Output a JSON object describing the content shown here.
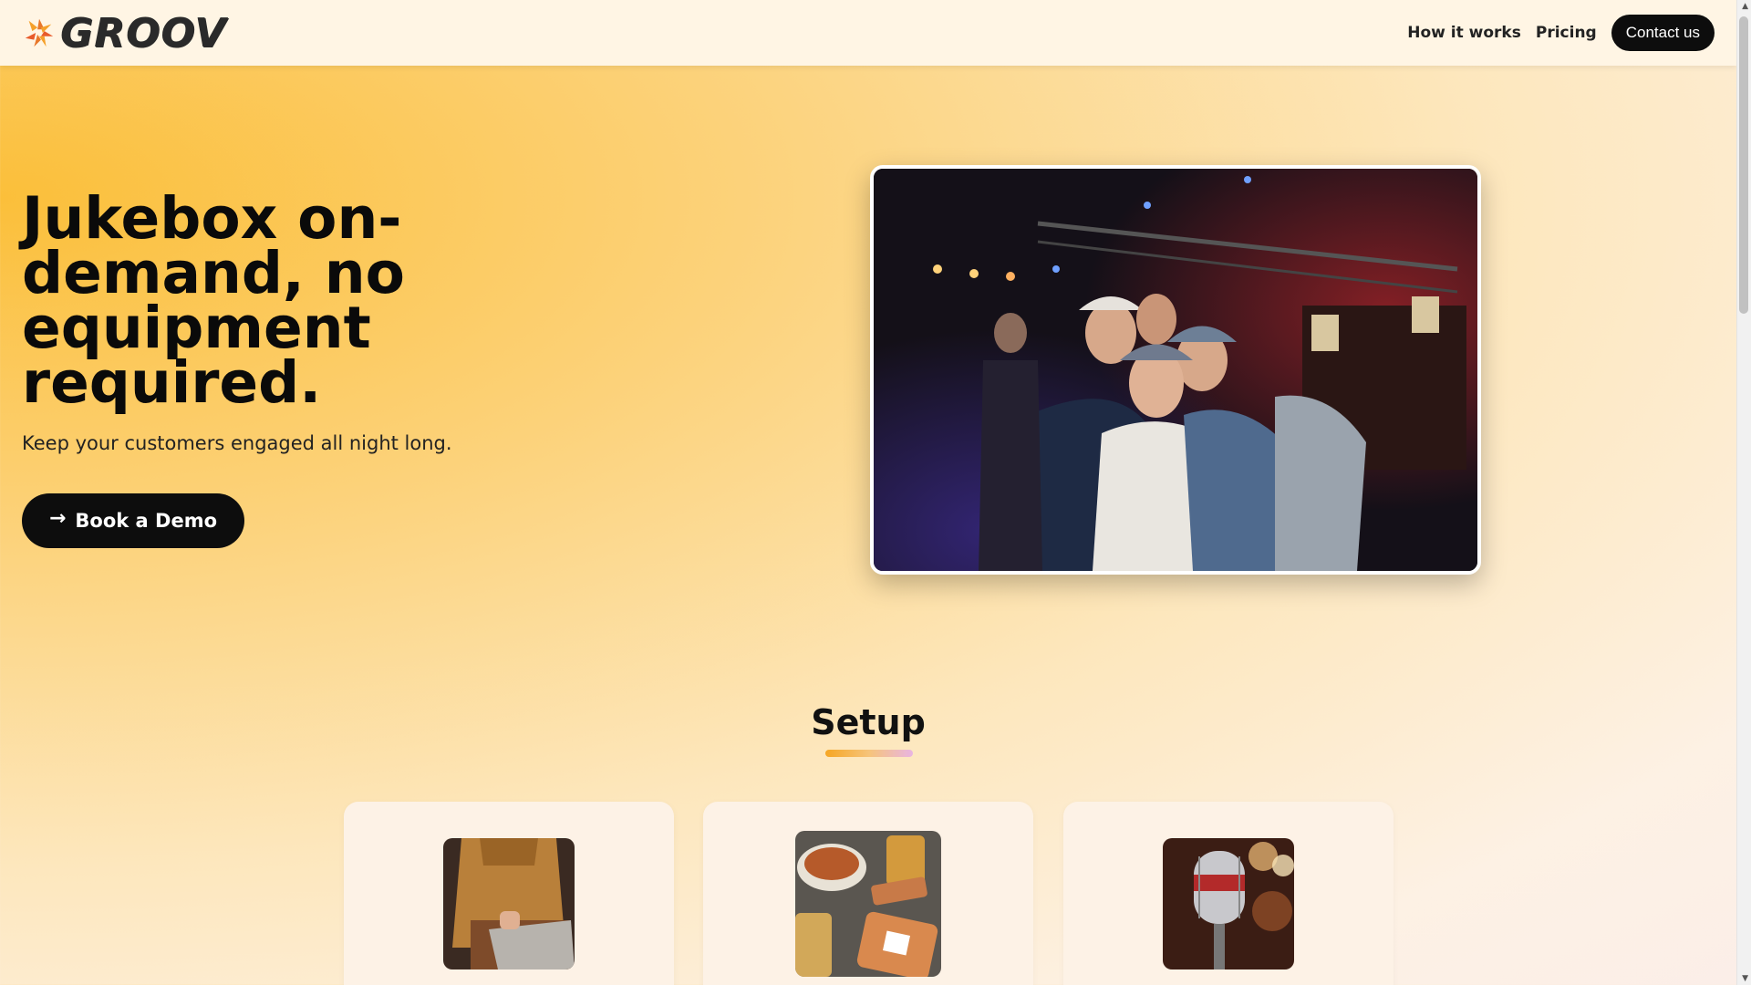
{
  "nav": {
    "brand": "GROOV",
    "brand_icon": "groov-logo-icon",
    "links": [
      {
        "label": "How it works"
      },
      {
        "label": "Pricing"
      }
    ],
    "contact_label": "Contact us"
  },
  "hero": {
    "title": "Jukebox on-demand, no equipment required.",
    "subtitle": "Keep your customers engaged all night long.",
    "cta_label": "Book a Demo",
    "cta_icon": "arrow-right-icon",
    "photo": "group-of-friends-at-bar-photo"
  },
  "setup": {
    "title": "Setup",
    "cards": [
      {
        "image": "person-with-laptop-photo"
      },
      {
        "image": "drinks-and-qr-coaster-photo"
      },
      {
        "image": "vintage-microphone-photo"
      }
    ]
  },
  "colors": {
    "accent": "#f6a623",
    "button": "#0d0d0d",
    "nav_bg": "#fff5e4"
  }
}
